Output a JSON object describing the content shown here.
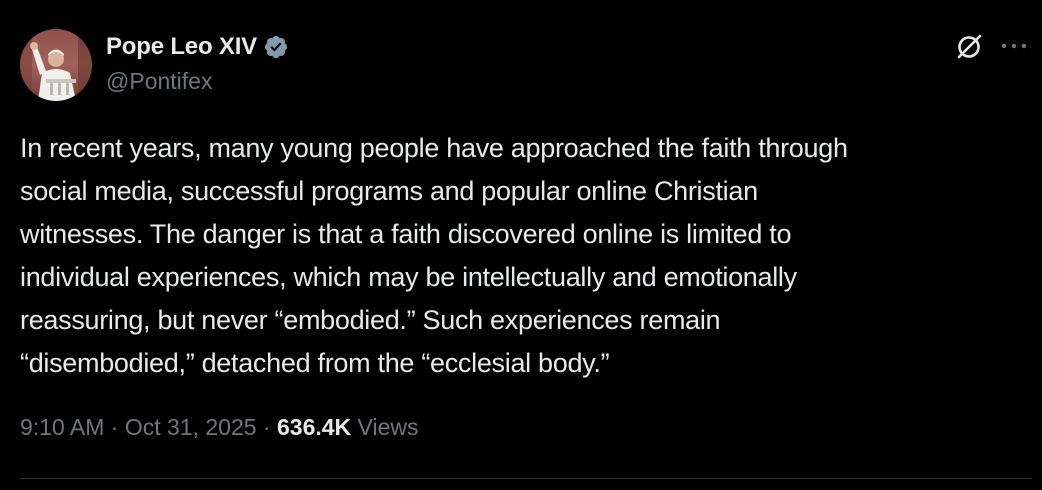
{
  "author": {
    "display_name": "Pope Leo XIV",
    "handle": "@Pontifex",
    "verified": true,
    "verified_color": "#829aab"
  },
  "tweet": {
    "text": "In recent years, many young people have approached the faith through\nsocial media, successful programs and popular online Christian\nwitnesses. The danger is that a faith discovered online is limited to\nindividual experiences, which may be intellectually and emotionally\nreassuring, but never “embodied.” Such experiences remain\n“disembodied,” detached from the “ecclesial body.”"
  },
  "meta": {
    "time": "9:10 AM",
    "separator": " · ",
    "date": "Oct 31, 2025",
    "views_count": "636.4K",
    "views_label": " Views"
  },
  "icons": {
    "grok": "grok-icon",
    "more": "more-options-icon"
  },
  "colors": {
    "background": "#000000",
    "primary_text": "#e7e9ea",
    "secondary_text": "#71767b",
    "divider": "#2f3336"
  }
}
